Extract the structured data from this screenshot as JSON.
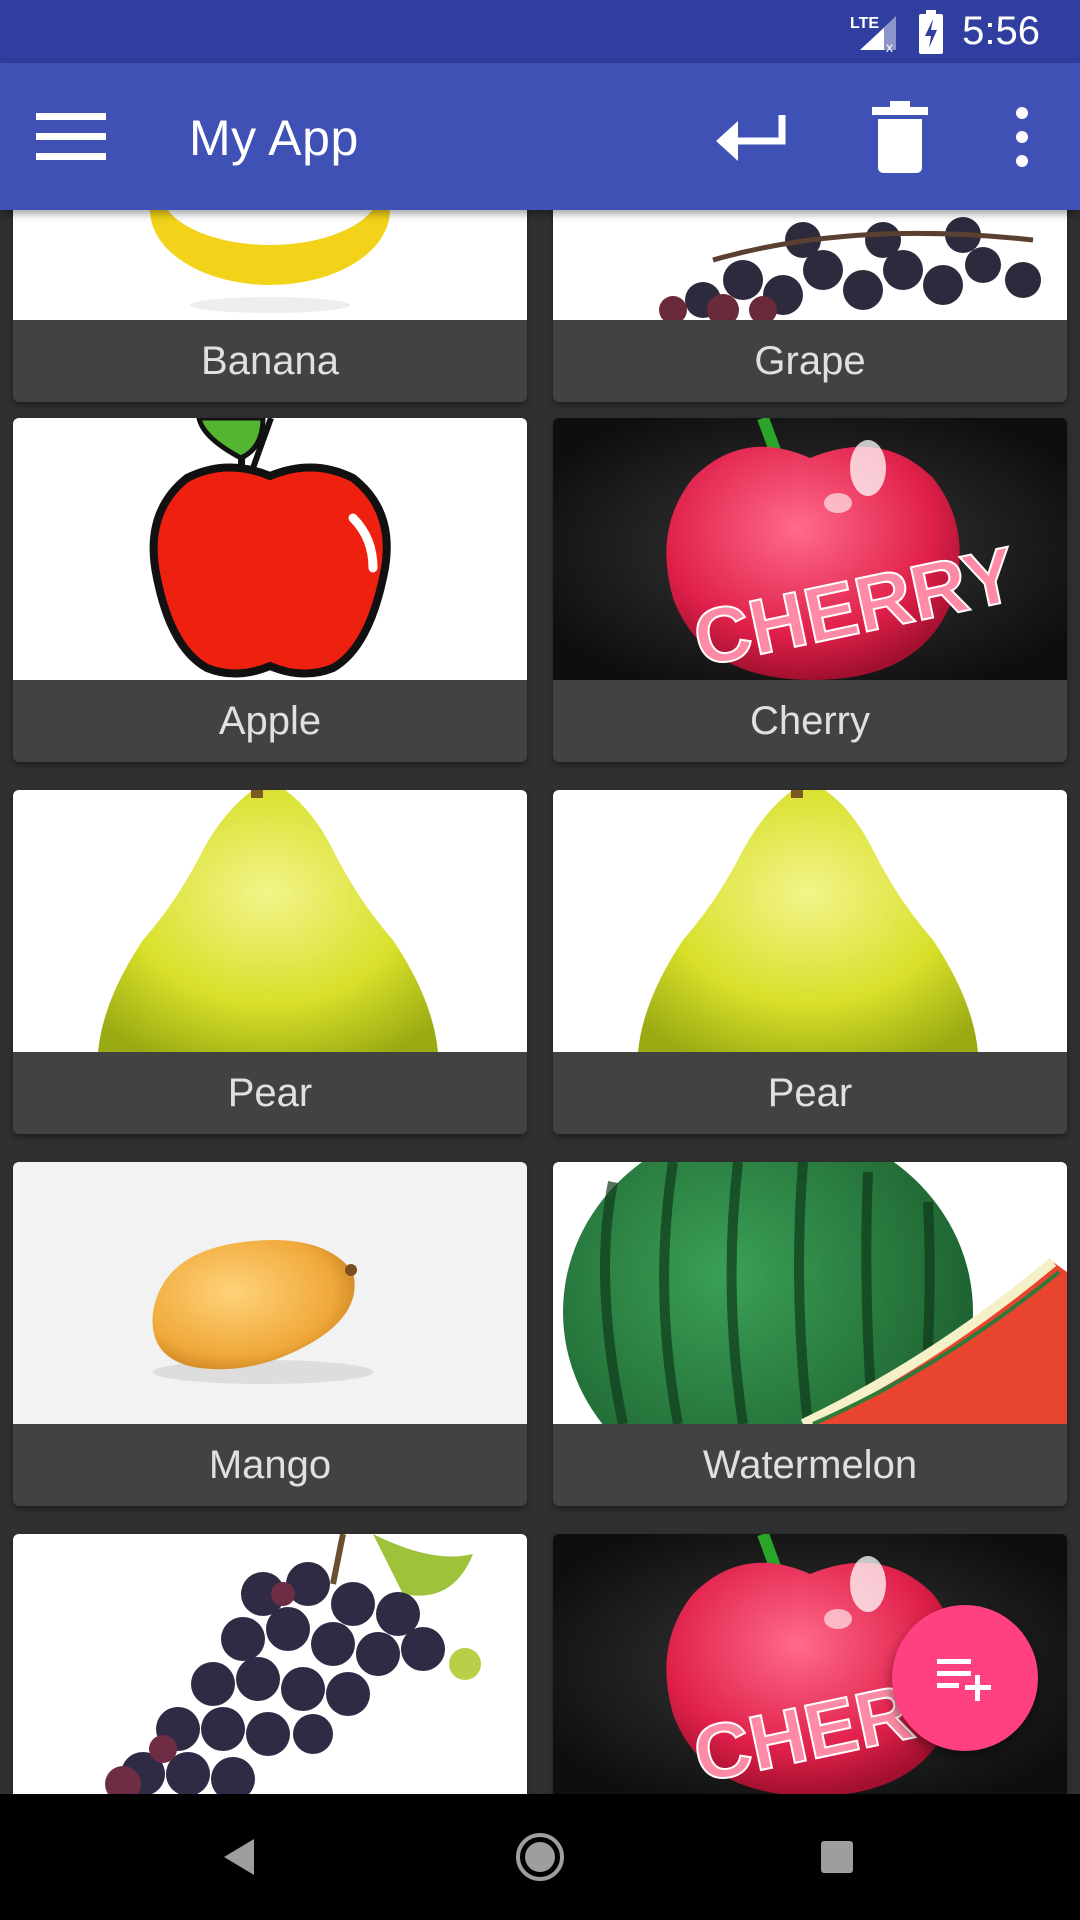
{
  "status_bar": {
    "time": "5:56",
    "network": "LTE",
    "icons": [
      "lte-signal-icon",
      "battery-charging-icon"
    ]
  },
  "app_bar": {
    "title": "My App",
    "actions": [
      "menu-icon",
      "keyboard-return-icon",
      "trash-icon",
      "more-vert-icon"
    ]
  },
  "grid": {
    "items": [
      {
        "label": "Banana"
      },
      {
        "label": "Grape"
      },
      {
        "label": "Apple"
      },
      {
        "label": "Cherry"
      },
      {
        "label": "Pear"
      },
      {
        "label": "Pear"
      },
      {
        "label": "Mango"
      },
      {
        "label": "Watermelon"
      },
      {
        "label": ""
      },
      {
        "label": ""
      }
    ],
    "image_word": "CHERRY"
  },
  "fab": {
    "icon": "playlist-add-icon"
  },
  "nav_bar": {
    "icons": [
      "back-triangle-icon",
      "home-circle-icon",
      "recents-square-icon"
    ]
  },
  "colors": {
    "status_bar": "#303f9f",
    "app_bar": "#3f51b5",
    "background": "#303030",
    "card_label": "#424242",
    "fab": "#ff4081"
  }
}
